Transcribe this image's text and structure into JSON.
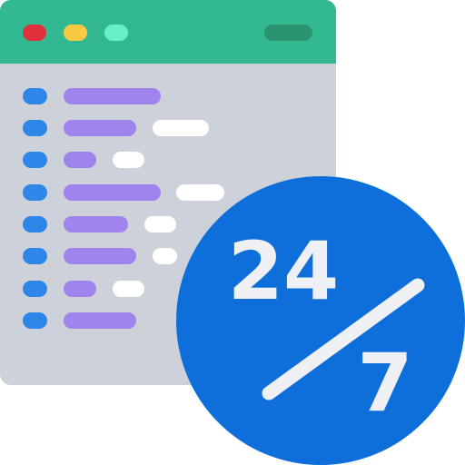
{
  "icon": {
    "name": "24-7-code-support-icon",
    "window": {
      "title_bar_color": "#33b992",
      "body_color": "#cdd1d9",
      "window_dots": [
        "red-dot",
        "yellow-dot",
        "mint-dot"
      ],
      "code_lines": 8
    },
    "badge": {
      "color": "#0e6fdb",
      "glyph_color": "#eef0f4",
      "top_number": "24",
      "bottom_number": "7"
    }
  }
}
